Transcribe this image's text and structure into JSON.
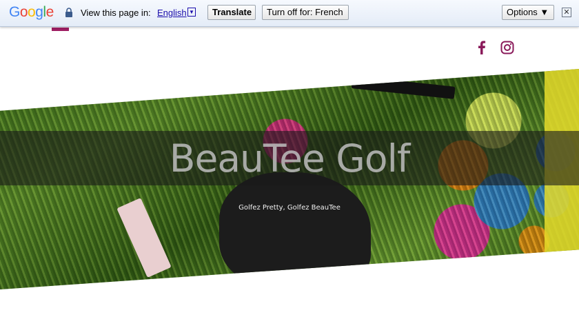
{
  "translate_bar": {
    "logo": [
      "G",
      "o",
      "o",
      "g",
      "l",
      "e"
    ],
    "logo_colors": [
      "#4285f4",
      "#ea4335",
      "#fbbc05",
      "#4285f4",
      "#34a853",
      "#ea4335"
    ],
    "prompt": "View this page in:",
    "language": "English",
    "translate_label": "Translate",
    "turn_off_label": "Turn off for: French",
    "options_label": "Options ▼",
    "close_glyph": "✕",
    "dropdown_glyph": "▼"
  },
  "site": {
    "accent_color": "#9e1e63",
    "social": [
      {
        "name": "facebook-icon"
      },
      {
        "name": "instagram-icon"
      }
    ],
    "hero": {
      "title": "BeauTee Golf",
      "tagline": "Golfez Pretty, Golfez BeauTee"
    }
  }
}
